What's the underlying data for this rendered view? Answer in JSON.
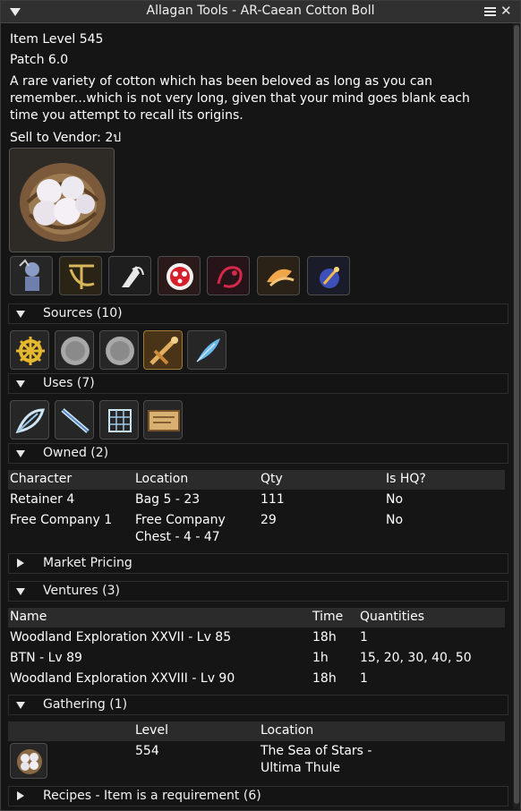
{
  "window": {
    "title": "Allagan Tools - AR-Caean Cotton Boll"
  },
  "item": {
    "level": "Item Level 545",
    "patch": "Patch 6.0",
    "description": "A rare variety of cotton which has been beloved as long as you can remember...which is not very long, given that your mind goes blank each time you attempt to recall its origins.",
    "sell": "Sell to Vendor: 2ป"
  },
  "job_icons": [
    "retainer-icon",
    "botanist-icon",
    "weaver-icon",
    "moogle-icon",
    "dragon-icon",
    "fish-icon",
    "materia-icon"
  ],
  "sections": {
    "sources": {
      "label": "Sources (10)",
      "icons": [
        "helm-icon",
        "coin-icon",
        "coin-icon",
        "tools-icon",
        "feather-icon"
      ]
    },
    "uses": {
      "label": "Uses (7)",
      "icons": [
        "feather-leaf-icon",
        "needle-icon",
        "net-icon",
        "scroll-icon"
      ]
    },
    "owned": {
      "label": "Owned (2)",
      "columns": [
        "Character",
        "Location",
        "Qty",
        "Is HQ?"
      ],
      "rows": [
        {
          "character": "Retainer 4",
          "location": "Bag 5 - 23",
          "qty": "111",
          "hq": "No"
        },
        {
          "character": "Free Company 1",
          "location_1": "Free Company",
          "location_2": "Chest - 4 - 47",
          "qty": "29",
          "hq": "No"
        }
      ]
    },
    "market": {
      "label": "Market Pricing"
    },
    "ventures": {
      "label": "Ventures (3)",
      "columns": [
        "Name",
        "Time",
        "Quantities"
      ],
      "rows": [
        {
          "name": "Woodland Exploration XXVII - Lv 85",
          "time": "18h",
          "qty": "1"
        },
        {
          "name": "BTN - Lv 89",
          "time": "1h",
          "qty": "15, 20, 30, 40, 50"
        },
        {
          "name": "Woodland Exploration XXVIII - Lv 90",
          "time": "18h",
          "qty": "1"
        }
      ]
    },
    "gathering": {
      "label": "Gathering (1)",
      "columns": [
        "Level",
        "Location"
      ],
      "row": {
        "level": "554",
        "location_1": "The Sea of Stars -",
        "location_2": "Ultima Thule"
      }
    },
    "recipes": {
      "label": "Recipes - Item is a requirement (6)"
    }
  }
}
